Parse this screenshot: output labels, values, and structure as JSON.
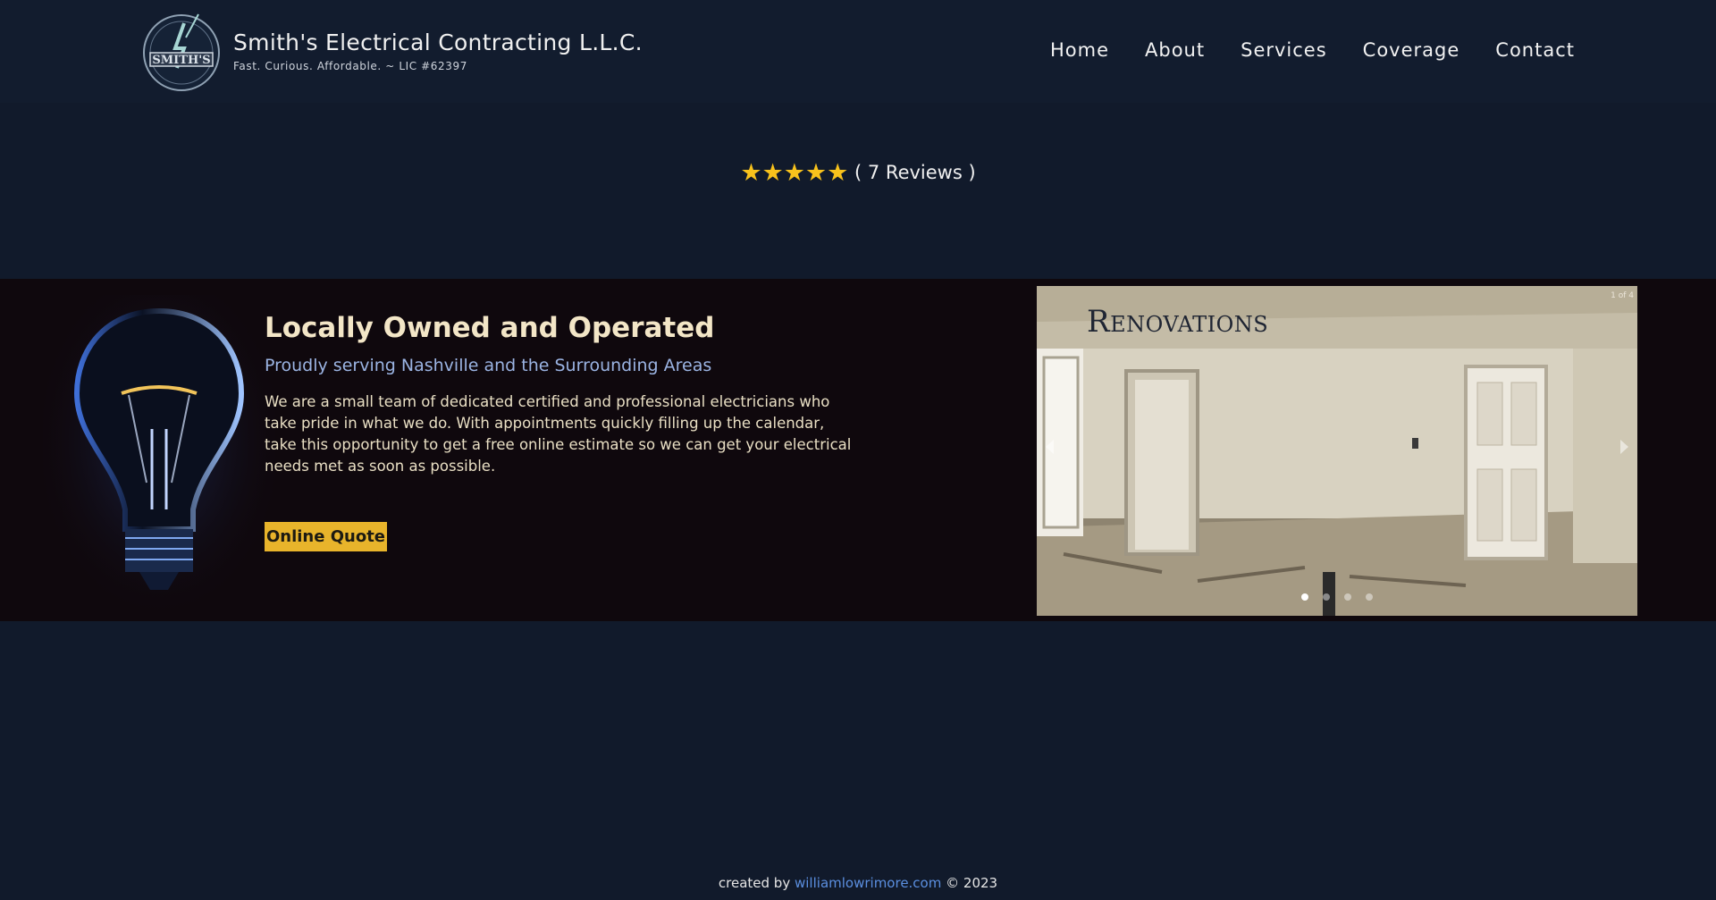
{
  "header": {
    "title": "Smith's Electrical Contracting L.L.C.",
    "subtitle": "Fast. Curious. Affordable. ~ LIC #62397",
    "logo_text": "SMITH'S",
    "nav": [
      {
        "label": "Home"
      },
      {
        "label": "About"
      },
      {
        "label": "Services"
      },
      {
        "label": "Coverage"
      },
      {
        "label": "Contact"
      }
    ]
  },
  "rating": {
    "stars": 5,
    "stars_glyphs": "★★★★★",
    "reviews": "( 7 Reviews )"
  },
  "intro": {
    "title": "Locally Owned and Operated",
    "subtitle": "Proudly serving Nashville and the Surrounding Areas",
    "body": "We are a small team of dedicated certified and professional electricians who take pride in what we do. With appointments quickly filling up the calendar, take this opportunity to get a free online estimate so we can get your electrical needs met as soon as possible.",
    "button": "Online Quote"
  },
  "slider": {
    "caption": "Renovations",
    "counter": "1 of 4",
    "total": 4,
    "current": 1
  },
  "footer": {
    "prefix": "created by",
    "link": "williamlowrimore.com",
    "suffix": "© 2023"
  },
  "colors": {
    "background": "#111a2b",
    "band": "#0f080d",
    "accent": "#e8b42b",
    "star": "#f8c21c",
    "link": "#5b8fe0"
  }
}
